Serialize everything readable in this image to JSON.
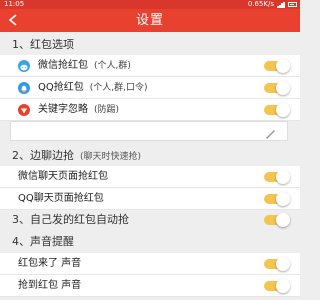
{
  "statusbar": {
    "time": "11:05",
    "speed": "0.65K/s"
  },
  "header": {
    "title": "设置",
    "back": "<"
  },
  "sections": {
    "hongbao": "1、红包选项",
    "biantan": "2、边聊边抢",
    "biantan_sub": "(聊天时快速抢)",
    "self": "3、自己发的红包自动抢",
    "sound": "4、声音提醒"
  },
  "rows": {
    "wechat": {
      "label": "微信抢红包",
      "hint": "(个人,群)",
      "on": true
    },
    "qq": {
      "label": "QQ抢红包",
      "hint": "(个人,群,口令)",
      "on": true
    },
    "keyword": {
      "label": "关键字忽略",
      "hint": "(防踢)",
      "on": true
    },
    "wechat_chat": {
      "label": "微信聊天页面抢红包",
      "on": true
    },
    "qq_chat": {
      "label": "QQ聊天页面抢红包",
      "on": true
    },
    "self_auto": {
      "on": true
    },
    "sound_arrive": {
      "label": "红包来了 声音",
      "on": true
    },
    "sound_grab": {
      "label": "抢到红包 声音",
      "on": true
    }
  },
  "keyword_input": {
    "value": "",
    "placeholder": ""
  },
  "icons": {
    "wechat": "wechat-icon",
    "qq": "qq-icon",
    "keyword": "filter-icon",
    "edit": "pencil-icon",
    "back": "back-arrow-icon"
  },
  "colors": {
    "primary": "#e8412f",
    "toggle_on": "#f3c54e"
  }
}
